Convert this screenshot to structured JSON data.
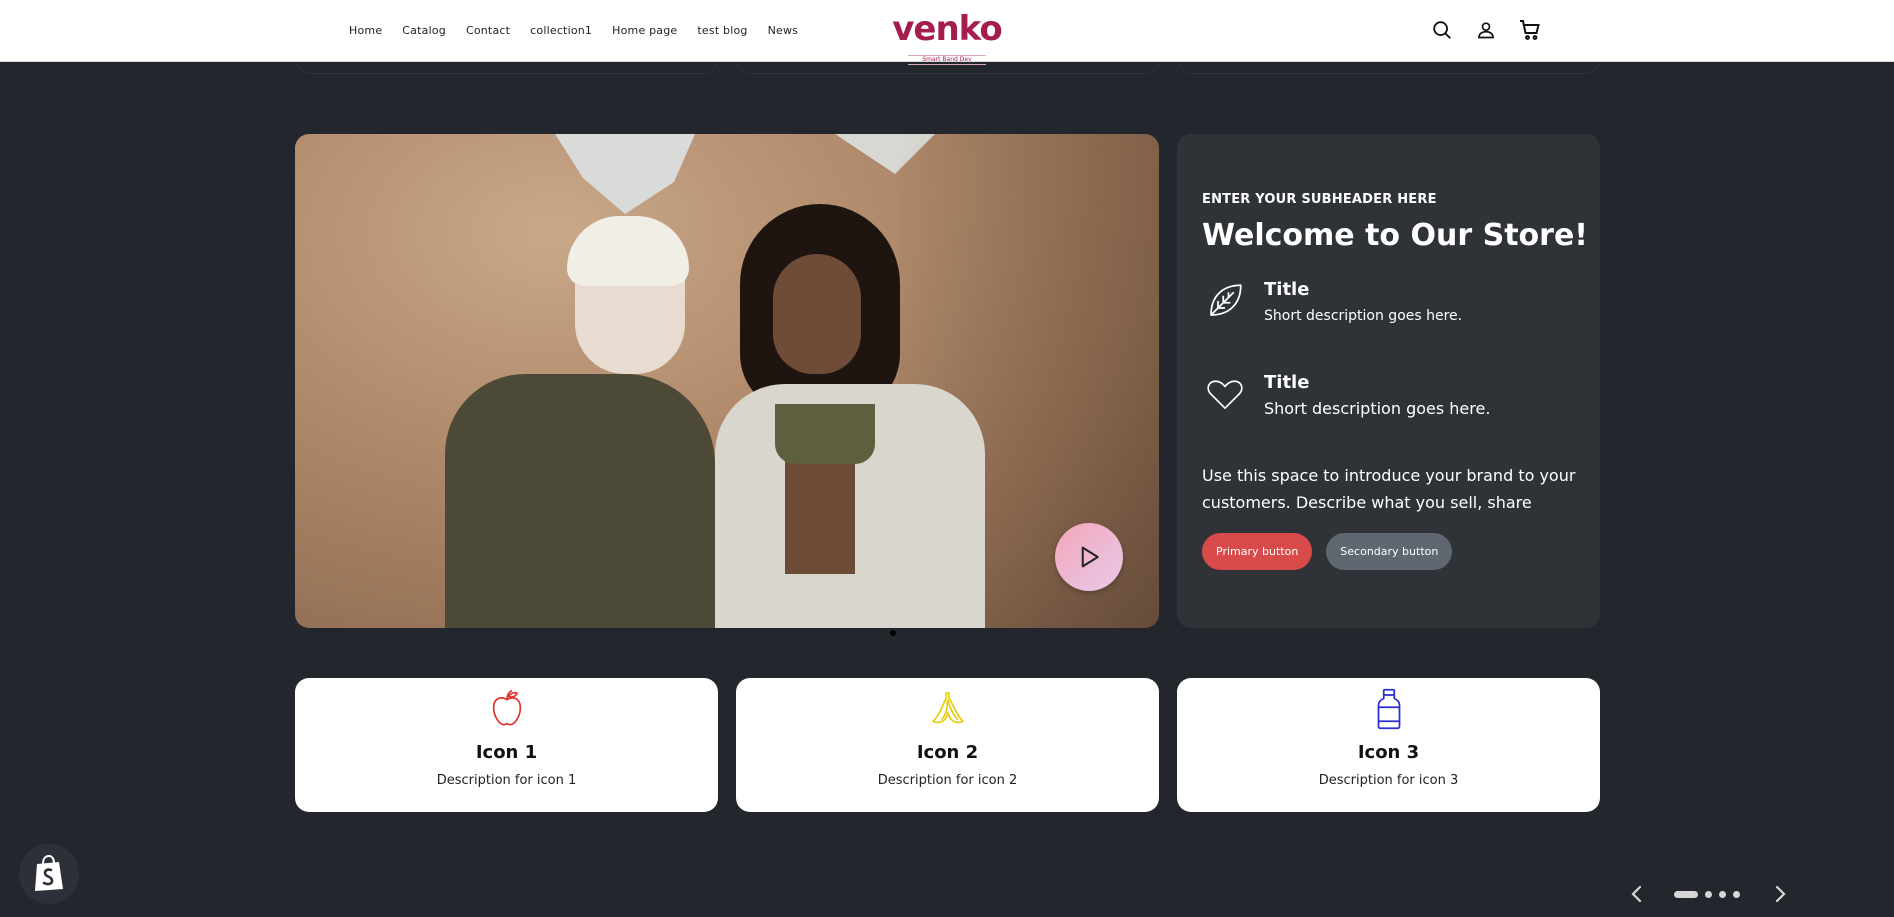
{
  "nav": {
    "items": [
      "Home",
      "Catalog",
      "Contact",
      "collection1",
      "Home page",
      "test blog",
      "News"
    ]
  },
  "logo": {
    "name": "venko",
    "tagline": "Smart Band Dev"
  },
  "header_icons": [
    "search-icon",
    "account-icon",
    "cart-icon"
  ],
  "hero": {
    "play_icon": "play-icon",
    "slide_count": 1
  },
  "info": {
    "subheader": "ENTER YOUR SUBHEADER HERE",
    "heading": "Welcome to Our Store!",
    "features": [
      {
        "icon": "leaf-icon",
        "title": "Title",
        "description": "Short description goes here."
      },
      {
        "icon": "heart-icon",
        "title": "Title",
        "description": "Short description goes here."
      }
    ],
    "intro": "Use this space to introduce your brand to your customers. Describe what you sell, share",
    "primary_button": "Primary button",
    "secondary_button": "Secondary button"
  },
  "cards": [
    {
      "icon": "apple-icon",
      "color": "#e0302a",
      "title": "Icon 1",
      "description": "Description for icon 1"
    },
    {
      "icon": "banana-icon",
      "color": "#f0d41a",
      "title": "Icon 2",
      "description": "Description for icon 2"
    },
    {
      "icon": "bottle-icon",
      "color": "#2b2fd1",
      "title": "Icon 3",
      "description": "Description for icon 3"
    }
  ],
  "colors": {
    "background": "#23262c",
    "brand": "#a51d4e",
    "primary_button": "#d94a4a",
    "secondary_button": "#5f6770",
    "panel": "#2f3338"
  },
  "slider": {
    "dots": 4,
    "active": 1
  }
}
